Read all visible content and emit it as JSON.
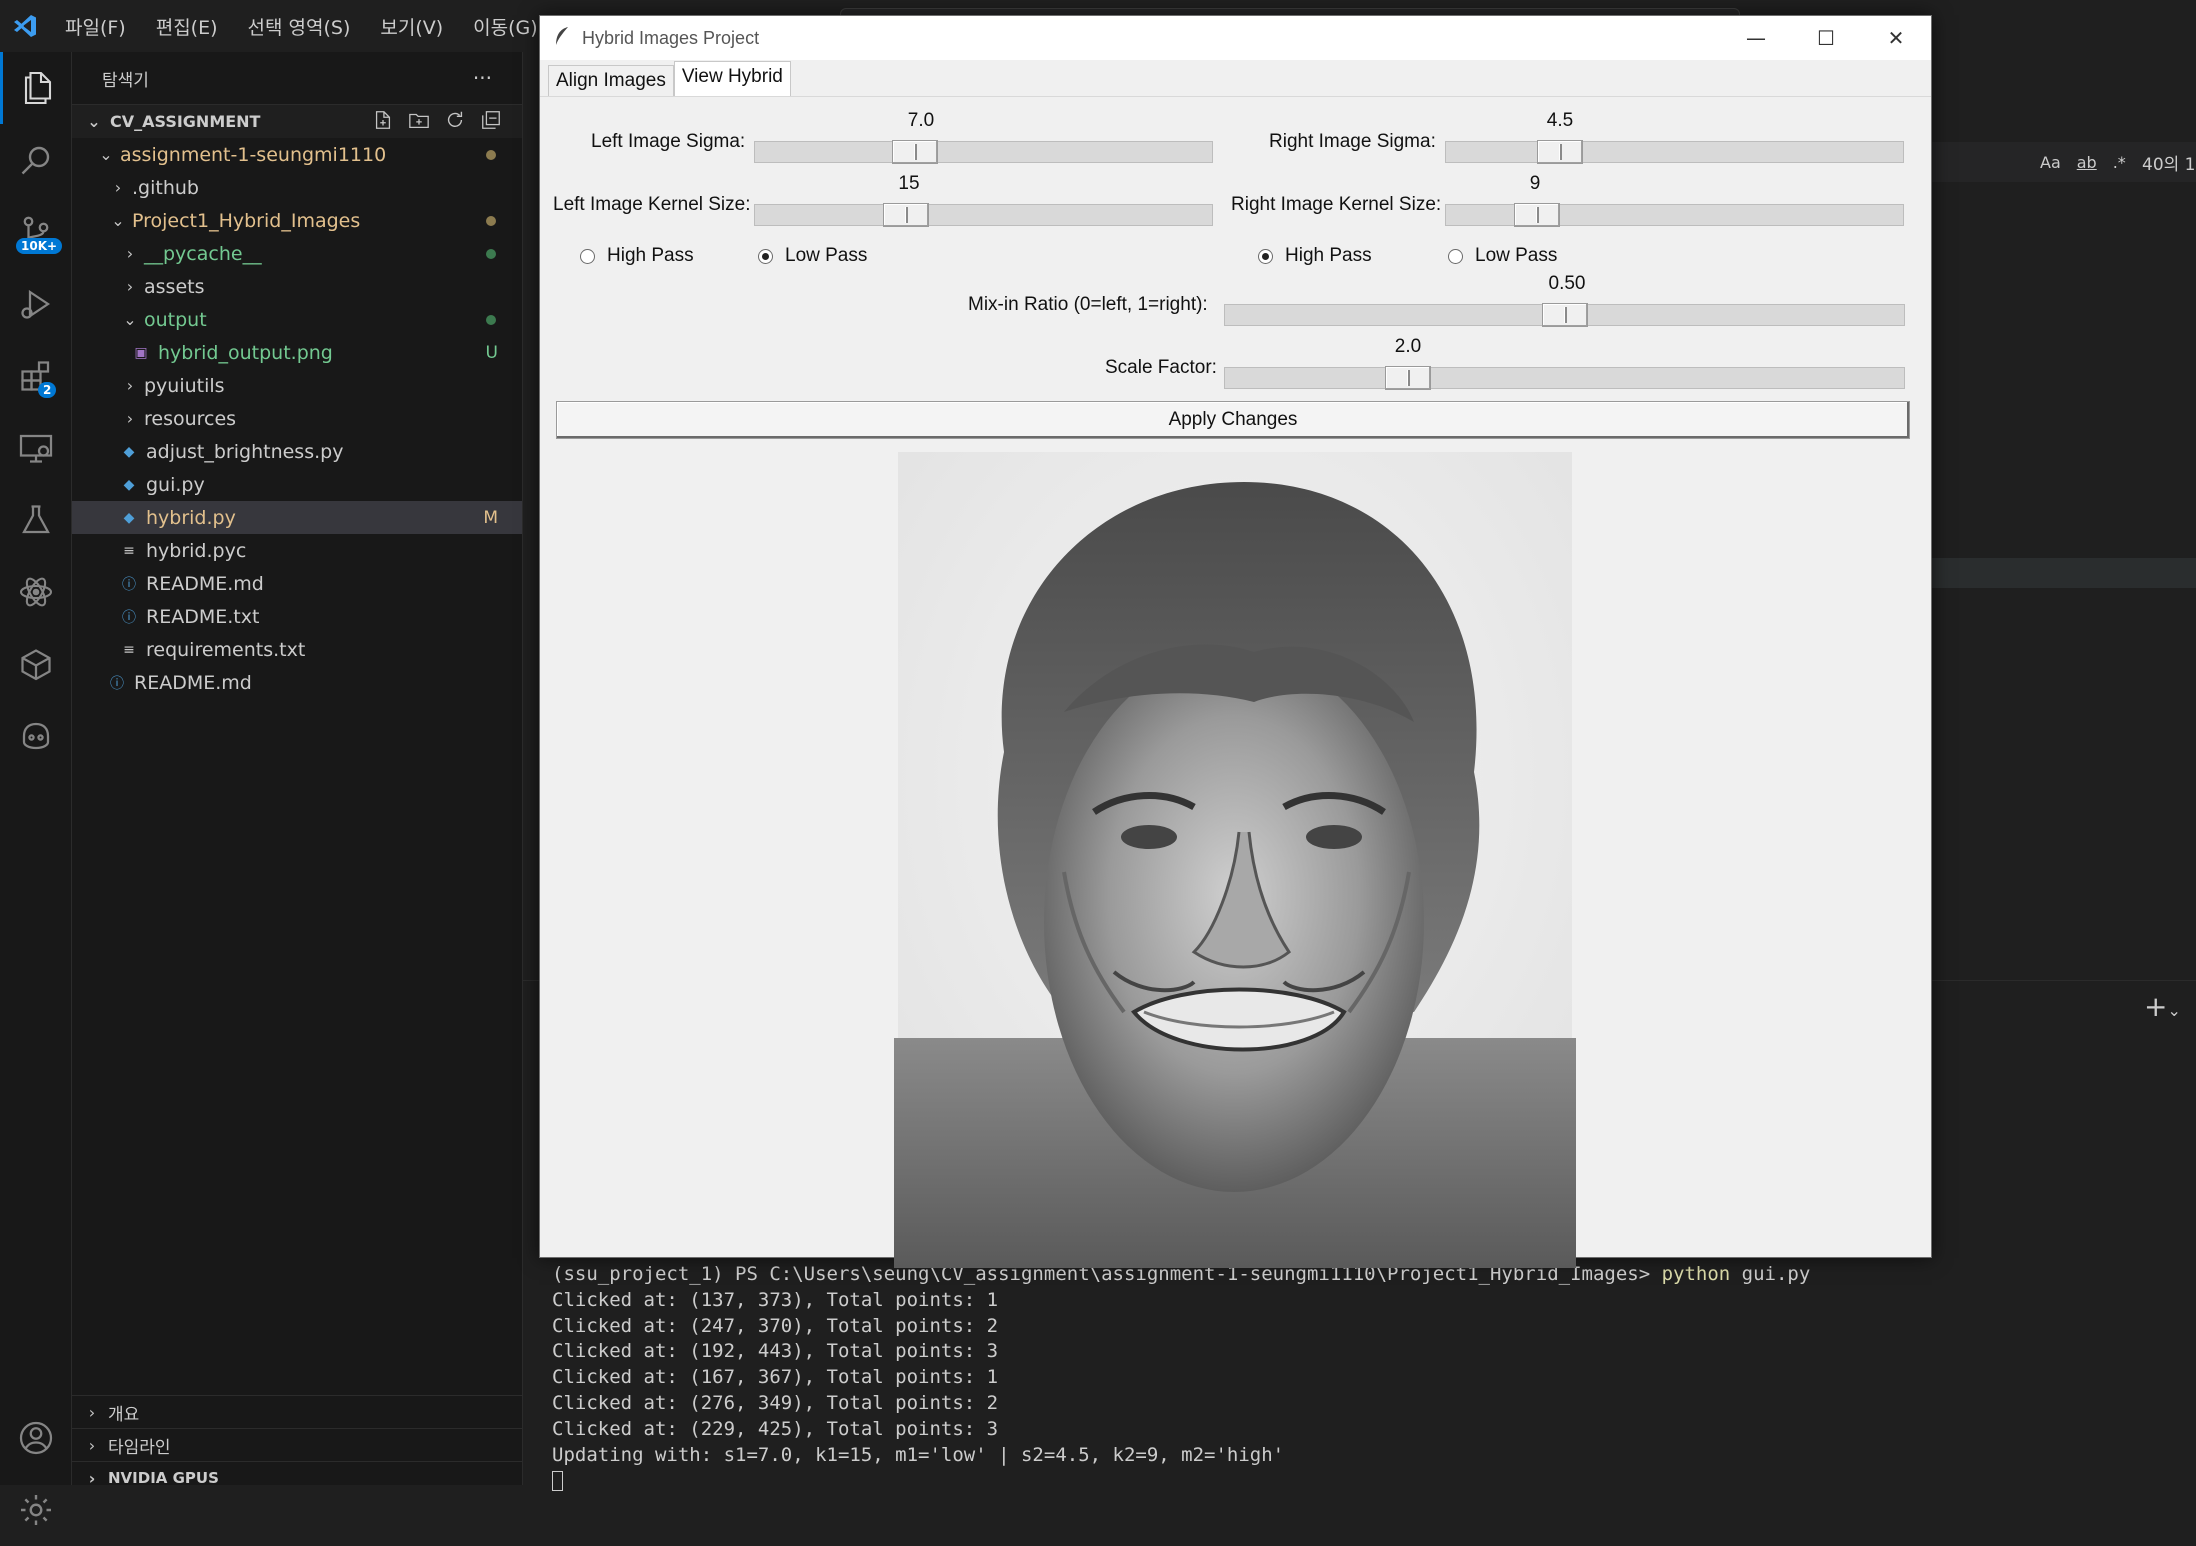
{
  "menubar": {
    "items": [
      "파일(F)",
      "편집(E)",
      "선택 영역(S)",
      "보기(V)",
      "이동(G)"
    ]
  },
  "activitybar": {
    "scm_badge": "10K+",
    "extensions_badge": "2"
  },
  "explorer": {
    "title": "탐색기",
    "more": "···",
    "workspace": "CV_ASSIGNMENT",
    "rows": [
      {
        "label": "assignment-1-seungmi1110",
        "color": "#e2c08d",
        "status": "dot",
        "status_color": "#8c7b4f"
      },
      {
        "label": ".github",
        "color": "#cccccc",
        "status": "",
        "status_color": ""
      },
      {
        "label": "Project1_Hybrid_Images",
        "color": "#e2c08d",
        "status": "dot",
        "status_color": "#8c7b4f"
      },
      {
        "label": "__pycache__",
        "color": "#73c991",
        "status": "dot",
        "status_color": "#3c7a4f"
      },
      {
        "label": "assets",
        "color": "#cccccc",
        "status": "",
        "status_color": ""
      },
      {
        "label": "output",
        "color": "#73c991",
        "status": "dot",
        "status_color": "#3c7a4f"
      },
      {
        "label": "hybrid_output.png",
        "color": "#73c991",
        "status": "U",
        "status_color": "#73c991"
      },
      {
        "label": "pyuiutils",
        "color": "#cccccc",
        "status": "",
        "status_color": ""
      },
      {
        "label": "resources",
        "color": "#cccccc",
        "status": "",
        "status_color": ""
      },
      {
        "label": "adjust_brightness.py",
        "color": "#cccccc",
        "status": "",
        "status_color": ""
      },
      {
        "label": "gui.py",
        "color": "#cccccc",
        "status": "",
        "status_color": ""
      },
      {
        "label": "hybrid.py",
        "color": "#e2c08d",
        "status": "M",
        "status_color": "#e2c08d"
      },
      {
        "label": "hybrid.pyc",
        "color": "#cccccc",
        "status": "",
        "status_color": ""
      },
      {
        "label": "README.md",
        "color": "#cccccc",
        "status": "",
        "status_color": ""
      },
      {
        "label": "README.txt",
        "color": "#cccccc",
        "status": "",
        "status_color": ""
      },
      {
        "label": "requirements.txt",
        "color": "#cccccc",
        "status": "",
        "status_color": ""
      },
      {
        "label": "README.md",
        "color": "#cccccc",
        "status": "",
        "status_color": ""
      }
    ],
    "bottom_sections": [
      "개요",
      "타임라인",
      "NVIDIA GPUS"
    ]
  },
  "findbar": {
    "case": "Aa",
    "word": "ab",
    "regex": ".*",
    "count": "40의 1"
  },
  "tk": {
    "title": "Hybrid Images Project",
    "tabs": [
      "Align Images",
      "View Hybrid"
    ],
    "left_sigma_label": "Left Image Sigma:",
    "left_sigma_value": "7.0",
    "left_sigma_level": 0.35,
    "right_sigma_label": "Right Image Sigma:",
    "right_sigma_value": "4.5",
    "right_sigma_level": 0.25,
    "left_kernel_label": "Left Image Kernel Size:",
    "left_kernel_value": "15",
    "left_kernel_level": 0.33,
    "right_kernel_label": "Right Image Kernel Size:",
    "right_kernel_value": "9",
    "right_kernel_level": 0.2,
    "high_pass": "High Pass",
    "low_pass": "Low Pass",
    "left_mode": "low",
    "right_mode": "high",
    "mix_label": "Mix-in Ratio (0=left, 1=right):",
    "mix_value": "0.50",
    "mix_level": 0.5,
    "scale_label": "Scale Factor:",
    "scale_value": "2.0",
    "scale_level": 0.27,
    "apply": "Apply Changes"
  },
  "terminal": {
    "prompt": "(ssu_project_1) PS C:\\Users\\seung\\CV_assignment\\assignment-1-seungmi1110\\Project1_Hybrid_Images> ",
    "cmd": "python",
    "arg": " gui.py",
    "lines": [
      "Clicked at: (137, 373), Total points: 1",
      "Clicked at: (247, 370), Total points: 2",
      "Clicked at: (192, 443), Total points: 3",
      "Clicked at: (167, 367), Total points: 1",
      "Clicked at: (276, 349), Total points: 2",
      "Clicked at: (229, 425), Total points: 3",
      "Updating with: s1=7.0, k1=15, m1='low' | s2=4.5, k2=9, m2='high'"
    ]
  }
}
